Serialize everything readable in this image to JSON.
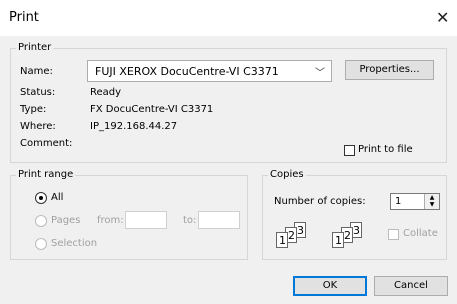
{
  "dialog": {
    "title": "Print",
    "close_glyph": "✕"
  },
  "printer": {
    "group_label": "Printer",
    "name_label": "Name:",
    "name_value": "FUJI XEROX DocuCentre-VI C3371",
    "properties_button": "Properties...",
    "status_label": "Status:",
    "status_value": "Ready",
    "type_label": "Type:",
    "type_value": "FX DocuCentre-VI C3371",
    "where_label": "Where:",
    "where_value": "IP_192.168.44.27",
    "comment_label": "Comment:",
    "print_to_file": "Print to file"
  },
  "print_range": {
    "group_label": "Print range",
    "all": "All",
    "pages": "Pages",
    "from": "from:",
    "to": "to:",
    "selection": "Selection"
  },
  "copies": {
    "group_label": "Copies",
    "number_label": "Number of copies:",
    "number_value": "1",
    "collate": "Collate",
    "page_numbers": [
      "1",
      "2",
      "3"
    ]
  },
  "buttons": {
    "ok": "OK",
    "cancel": "Cancel"
  }
}
